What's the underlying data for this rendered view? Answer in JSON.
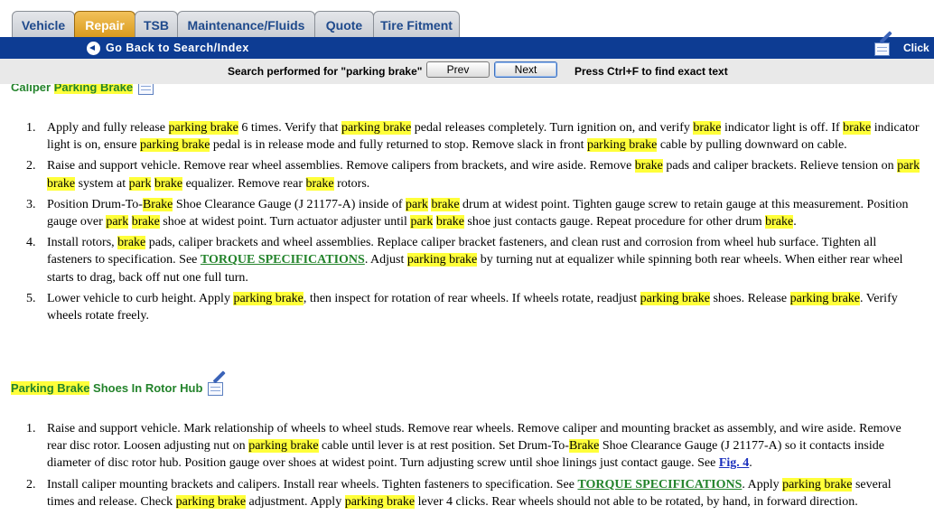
{
  "tabs": [
    {
      "label": "Vehicle",
      "active": false
    },
    {
      "label": "Repair",
      "active": true
    },
    {
      "label": "TSB",
      "active": false
    },
    {
      "label": "Maintenance/Fluids",
      "active": false
    },
    {
      "label": "Quote",
      "active": false
    },
    {
      "label": "Tire Fitment",
      "active": false
    }
  ],
  "header": {
    "back_label": "Go Back to Search/Index",
    "click_label": "Click"
  },
  "search": {
    "performed_text": "Search performed for \"parking brake\"",
    "prev_label": "Prev",
    "next_label": "Next",
    "hint_text": "Press Ctrl+F to find exact text"
  },
  "sections": [
    {
      "title_pre": "Caliper ",
      "title_hl": "Parking Brake",
      "title_post": "",
      "steps": [
        {
          "num": "1.",
          "parts": [
            {
              "t": "Apply and fully release "
            },
            {
              "t": "parking brake",
              "hl": true
            },
            {
              "t": " 6 times. Verify that "
            },
            {
              "t": "parking brake",
              "hl": true
            },
            {
              "t": " pedal releases completely. Turn ignition on, and verify "
            },
            {
              "t": "brake",
              "hl": true
            },
            {
              "t": " indicator light is off. If "
            },
            {
              "t": "brake",
              "hl": true
            },
            {
              "t": " indicator light is on, ensure "
            },
            {
              "t": "parking brake",
              "hl": true
            },
            {
              "t": " pedal is in release mode and fully returned to stop. Remove slack in front "
            },
            {
              "t": "parking brake",
              "hl": true
            },
            {
              "t": " cable by pulling downward on cable."
            }
          ]
        },
        {
          "num": "2.",
          "parts": [
            {
              "t": "Raise and support vehicle. Remove rear wheel assemblies. Remove calipers from brackets, and wire aside. Remove "
            },
            {
              "t": "brake",
              "hl": true
            },
            {
              "t": " pads and caliper brackets. Relieve tension on "
            },
            {
              "t": "park",
              "hl": true
            },
            {
              "t": " "
            },
            {
              "t": "brake",
              "hl": true
            },
            {
              "t": " system at "
            },
            {
              "t": "park",
              "hl": true
            },
            {
              "t": " "
            },
            {
              "t": "brake",
              "hl": true
            },
            {
              "t": " equalizer. Remove rear "
            },
            {
              "t": "brake",
              "hl": true
            },
            {
              "t": " rotors."
            }
          ]
        },
        {
          "num": "3.",
          "parts": [
            {
              "t": "Position Drum-To-"
            },
            {
              "t": "Brake",
              "hl": true
            },
            {
              "t": " Shoe Clearance Gauge (J 21177-A) inside of "
            },
            {
              "t": "park",
              "hl": true
            },
            {
              "t": " "
            },
            {
              "t": "brake",
              "hl": true
            },
            {
              "t": " drum at widest point. Tighten gauge screw to retain gauge at this measurement. Position gauge over "
            },
            {
              "t": "park",
              "hl": true
            },
            {
              "t": " "
            },
            {
              "t": "brake",
              "hl": true
            },
            {
              "t": " shoe at widest point. Turn actuator adjuster until "
            },
            {
              "t": "park",
              "hl": true
            },
            {
              "t": " "
            },
            {
              "t": "brake",
              "hl": true
            },
            {
              "t": " shoe just contacts gauge. Repeat procedure for other drum "
            },
            {
              "t": "brake",
              "hl": true
            },
            {
              "t": "."
            }
          ]
        },
        {
          "num": "4.",
          "parts": [
            {
              "t": "Install rotors, "
            },
            {
              "t": "brake",
              "hl": true
            },
            {
              "t": " pads, caliper brackets and wheel assemblies. Replace caliper bracket fasteners, and clean rust and corrosion from wheel hub surface. Tighten all fasteners to specification. See "
            },
            {
              "t": "TORQUE SPECIFICATIONS",
              "link": "green"
            },
            {
              "t": ". Adjust "
            },
            {
              "t": "parking brake",
              "hl": true
            },
            {
              "t": " by turning nut at equalizer while spinning both rear wheels. When either rear wheel starts to drag, back off nut one full turn."
            }
          ]
        },
        {
          "num": "5.",
          "parts": [
            {
              "t": "Lower vehicle to curb height. Apply "
            },
            {
              "t": "parking brake",
              "hl": true
            },
            {
              "t": ", then inspect for rotation of rear wheels. If wheels rotate, readjust "
            },
            {
              "t": "parking brake",
              "hl": true
            },
            {
              "t": " shoes. Release "
            },
            {
              "t": "parking brake",
              "hl": true
            },
            {
              "t": ". Verify wheels rotate freely."
            }
          ]
        }
      ]
    },
    {
      "title_pre": "",
      "title_hl": "Parking Brake",
      "title_post": " Shoes In Rotor Hub",
      "steps": [
        {
          "num": "1.",
          "parts": [
            {
              "t": "Raise and support vehicle. Mark relationship of wheels to wheel studs. Remove rear wheels. Remove caliper and mounting bracket as assembly, and wire aside. Remove rear disc rotor. Loosen adjusting nut on "
            },
            {
              "t": "parking brake",
              "hl": true
            },
            {
              "t": " cable until lever is at rest position. Set Drum-To-"
            },
            {
              "t": "Brake",
              "hl": true
            },
            {
              "t": " Shoe Clearance Gauge (J 21177-A) so it contacts inside diameter of disc rotor hub. Position gauge over shoes at widest point. Turn adjusting screw until shoe linings just contact gauge. See "
            },
            {
              "t": "Fig. 4",
              "link": "blue"
            },
            {
              "t": "."
            }
          ]
        },
        {
          "num": "2.",
          "parts": [
            {
              "t": "Install caliper mounting brackets and calipers. Install rear wheels. Tighten fasteners to specification. See "
            },
            {
              "t": "TORQUE SPECIFICATIONS",
              "link": "green"
            },
            {
              "t": ". Apply "
            },
            {
              "t": "parking brake",
              "hl": true
            },
            {
              "t": " several times and release. Check "
            },
            {
              "t": "parking brake",
              "hl": true
            },
            {
              "t": " adjustment. Apply "
            },
            {
              "t": "parking brake",
              "hl": true
            },
            {
              "t": " lever 4 clicks. Rear wheels should not able to be rotated, by hand, in forward direction."
            }
          ]
        }
      ]
    }
  ]
}
